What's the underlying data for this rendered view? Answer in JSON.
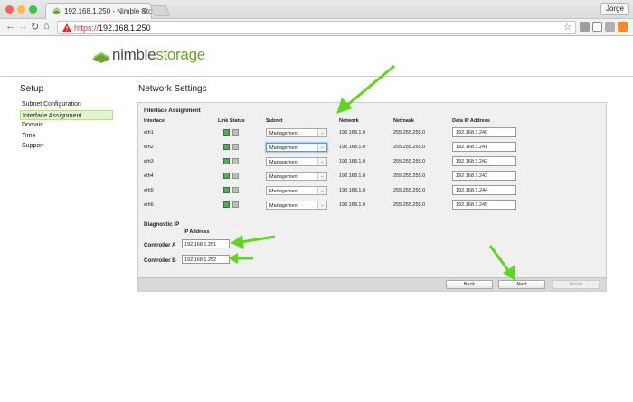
{
  "browser": {
    "tab_title": "192.168.1.250 - Nimble Stora",
    "tab_close": "×",
    "profile": "Jorge",
    "url_scheme": "https://",
    "url_host": "192.168.1.250",
    "back": "←",
    "forward": "→",
    "reload": "↻",
    "home": "⌂"
  },
  "logo": {
    "prefix": "nimble",
    "suffix": "storage"
  },
  "sidebar": {
    "title": "Setup",
    "items": [
      {
        "label": "Subnet Configuration"
      },
      {
        "label": "Interface Assignment"
      },
      {
        "label": "Domain"
      },
      {
        "label": "Time"
      },
      {
        "label": "Support"
      }
    ]
  },
  "main": {
    "title": "Network Settings",
    "interface_section": "Interface Assignment",
    "columns": [
      "Interface",
      "Link Status",
      "Subnet",
      "Network",
      "Netmask",
      "Data IP Address"
    ],
    "rows": [
      {
        "iface": "eth1",
        "subnet": "Management",
        "network": "192.168.1.0",
        "netmask": "255.255.255.0",
        "ip": "192.168.1.240"
      },
      {
        "iface": "eth2",
        "subnet": "Management",
        "network": "192.168.1.0",
        "netmask": "255.255.255.0",
        "ip": "192.168.1.241"
      },
      {
        "iface": "eth3",
        "subnet": "Management",
        "network": "192.168.1.0",
        "netmask": "255.255.255.0",
        "ip": "192.168.1.242"
      },
      {
        "iface": "eth4",
        "subnet": "Management",
        "network": "192.168.1.0",
        "netmask": "255.255.255.0",
        "ip": "192.168.1.243"
      },
      {
        "iface": "eth5",
        "subnet": "Management",
        "network": "192.168.1.0",
        "netmask": "255.255.255.0",
        "ip": "192.168.1.244"
      },
      {
        "iface": "eth6",
        "subnet": "Management",
        "network": "192.168.1.0",
        "netmask": "255.255.255.0",
        "ip": "192.168.1.245"
      }
    ],
    "diagnostic": {
      "title": "Diagnostic IP",
      "ip_header": "IP Address",
      "controller_a_label": "Controller A",
      "controller_a_ip": "192.168.1.251",
      "controller_b_label": "Controller B",
      "controller_b_ip": "192.168.1.252"
    },
    "buttons": {
      "back": "Back",
      "next": "Next",
      "finish": "Finish"
    }
  },
  "colors": {
    "accent_green": "#6aa62e",
    "arrow_green": "#5fd61f",
    "warning_red": "#d32f2f"
  }
}
